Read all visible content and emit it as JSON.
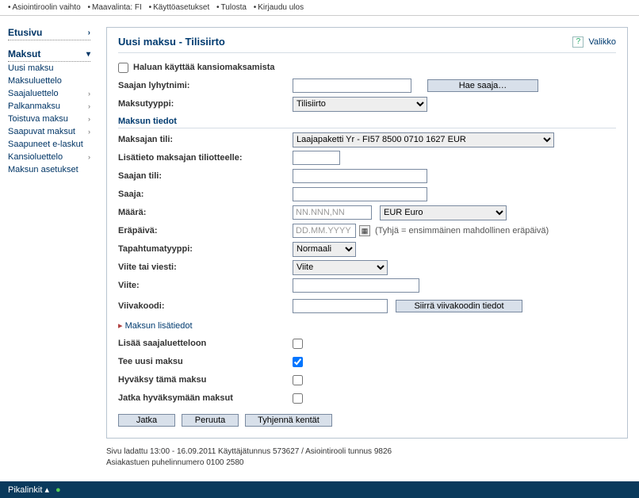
{
  "topbar": {
    "items": [
      "Asiointiroolin vaihto",
      "Maavalinta: FI",
      "Käyttöasetukset",
      "Tulosta",
      "Kirjaudu ulos"
    ]
  },
  "sidebar": {
    "sections": [
      {
        "label": "Etusivu",
        "open": false
      },
      {
        "label": "Maksut",
        "open": true,
        "items": [
          {
            "label": "Uusi maksu",
            "chevron": false
          },
          {
            "label": "Maksuluettelo",
            "chevron": false
          },
          {
            "label": "Saajaluettelo",
            "chevron": true
          },
          {
            "label": "Palkanmaksu",
            "chevron": true
          },
          {
            "label": "Toistuva maksu",
            "chevron": true
          },
          {
            "label": "Saapuvat maksut",
            "chevron": true
          },
          {
            "label": "Saapuneet e-laskut",
            "chevron": false
          },
          {
            "label": "Kansioluettelo",
            "chevron": true
          },
          {
            "label": "Maksun asetukset",
            "chevron": false
          }
        ]
      }
    ]
  },
  "panel": {
    "title": "Uusi maksu - Tilisiirto",
    "menu_label": "Valikko",
    "use_folder_label": "Haluan käyttää kansiomaksamista",
    "use_folder_checked": false,
    "fields": {
      "saajan_lyhytnimi_label": "Saajan lyhytnimi:",
      "hae_saaja_btn": "Hae saaja…",
      "maksutyyppi_label": "Maksutyyppi:",
      "maksutyyppi_value": "Tilisiirto",
      "maksun_tiedot_title": "Maksun tiedot",
      "maksajan_tili_label": "Maksajan tili:",
      "maksajan_tili_value": "Laajapaketti Yr - FI57 8500 0710 1627    EUR",
      "lisatieto_label": "Lisätieto maksajan tiliotteelle:",
      "saajan_tili_label": "Saajan tili:",
      "saaja_label": "Saaja:",
      "maara_label": "Määrä:",
      "maara_placeholder": "NN.NNN,NN",
      "valuutta_value": "EUR Euro",
      "erapaiva_label": "Eräpäivä:",
      "erapaiva_placeholder": "DD.MM.YYYY",
      "erapaiva_hint": "(Tyhjä = ensimmäinen mahdollinen eräpäivä)",
      "tapahtumatyyppi_label": "Tapahtumatyyppi:",
      "tapahtumatyyppi_value": "Normaali",
      "viite_tai_viesti_label": "Viite tai viesti:",
      "viite_tai_viesti_value": "Viite",
      "viite_label": "Viite:",
      "viivakoodi_label": "Viivakoodi:",
      "siirra_viivakoodi_btn": "Siirrä viivakoodin tiedot",
      "lisatiedot_link": "Maksun lisätiedot",
      "lisaa_saajaluetteloon_label": "Lisää saajaluetteloon",
      "tee_uusi_maksu_label": "Tee uusi maksu",
      "hyvaksy_label": "Hyväksy tämä maksu",
      "jatka_hyvaksy_label": "Jatka hyväksymään maksut"
    },
    "checks": {
      "lisaa_saajaluetteloon": false,
      "tee_uusi_maksu": true,
      "hyvaksy": false,
      "jatka_hyvaksy": false
    },
    "buttons": {
      "jatka": "Jatka",
      "peruuta": "Peruuta",
      "tyhjenna": "Tyhjennä kentät"
    }
  },
  "footer": {
    "line1": "Sivu ladattu 13:00 - 16.09.2011 Käyttäjätunnus 573627    / Asiointirooli tunnus 9826",
    "line2": "Asiakastuen puhelinnumero 0100 2580"
  },
  "bottombar": {
    "label": "Pikalinkit"
  }
}
